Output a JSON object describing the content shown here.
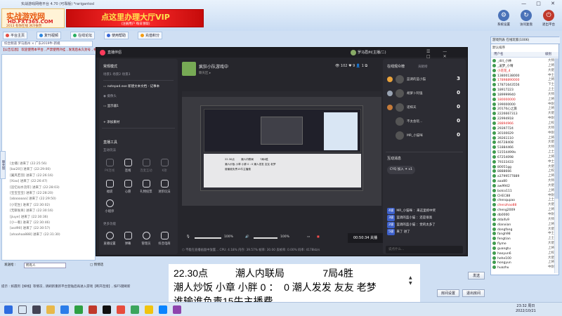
{
  "app": {
    "title": "实战游戏网络平台 4.70 (可靠版) *rarigantosl",
    "logo_big": "实战游戏网",
    "logo_url": "HD.FXT365.COM",
    "logo_sub": "2013 有你在线 冰冷依然",
    "vip_text": "点这里办理大厅VIP",
    "vip_sub": "(注册用户 每日领取)",
    "window_controls": "— □ ✕"
  },
  "top_buttons": [
    {
      "label": "系统设置",
      "icon": "gear-icon",
      "glyph": "⚙"
    },
    {
      "label": "访问复盘",
      "icon": "share-icon",
      "glyph": "↻"
    },
    {
      "label": "退出平台",
      "icon": "exit-icon",
      "glyph": "⏻"
    }
  ],
  "toolbar": [
    {
      "label": "平台主页",
      "color": "#e54d42"
    },
    {
      "label": "复刊视频",
      "color": "#2e86de"
    },
    {
      "label": "在线论坛",
      "color": "#27ae60"
    },
    {
      "label": "使用帮助",
      "color": "#3867d6"
    },
    {
      "label": "充值积分",
      "color": "#f39c12"
    }
  ],
  "chat": {
    "tabs": "综合频道   罗马眉州 × 广东2019牛·新规",
    "marquee": "【公告信息】 欢迎使用本平台 , 严禁使用外挂 , 发现后永久封号 , 祝您游戏愉快",
    "side_tab": "聊天窗",
    "log": [
      "[主播] 进来了 (22:25:56)",
      "[bai20]] 进来了 (22:29:00)",
      "[翼风若羽] 进来了 (22:26:16)",
      "[Xiao] 进来了 (22:26:47)",
      "[追忆似水流年] 进来了 (22:28:03)",
      "[宝宝宝宝] 进来了 (22:28:20)",
      "[abaaaaaa] 进来了 (22:29:50)",
      "[小花生] 进来了 (22:30:02)",
      "[无聊发呆] 进来了 (22:30:16)",
      "[jiuye] 进来了 (22:30:36)",
      "[小一看] 进来了 (22:30:46)",
      "[asd90] 进来了 (22:30:57)",
      "[ahaahaa888] 进来了 (22:31:30)"
    ]
  },
  "right_panel": {
    "tabs": "游戏列表   在线玩家(1006)",
    "default_filter": "默认排序",
    "col_user": "用户名",
    "col_level": "级别",
    "users": [
      {
        "name": "_dill_小林",
        "tag": "大师",
        "red": false
      },
      {
        "name": "_凌梦_小晴",
        "tag": "上将",
        "red": false
      },
      {
        "name": "小花花_4",
        "tag": "大佬",
        "red": true
      },
      {
        "name": "13800138000",
        "tag": "中士",
        "red": false
      },
      {
        "name": "17898890000",
        "tag": "上将",
        "red": true
      },
      {
        "name": "17871643556",
        "tag": "下士",
        "red": false
      },
      {
        "name": "18917223",
        "tag": "上士",
        "red": false
      },
      {
        "name": "189999940",
        "tag": "大师",
        "red": false
      },
      {
        "name": "180000000",
        "tag": "上将",
        "red": true
      },
      {
        "name": "199000000",
        "tag": "中尉",
        "red": false
      },
      {
        "name": "20170心之旅",
        "tag": "上将",
        "red": false
      },
      {
        "name": "2226667313",
        "tag": "大佬",
        "red": false
      },
      {
        "name": "22994918",
        "tag": "中尉",
        "red": false
      },
      {
        "name": "28894966",
        "tag": "上校",
        "red": true
      },
      {
        "name": "29397724",
        "tag": "大师",
        "red": false
      },
      {
        "name": "30100029",
        "tag": "中尉",
        "red": false
      },
      {
        "name": "39261110",
        "tag": "上将",
        "red": false
      },
      {
        "name": "46728408",
        "tag": "大佬",
        "red": false
      },
      {
        "name": "51884466",
        "tag": "大师",
        "red": false
      },
      {
        "name": "51554499ls",
        "tag": "上士",
        "red": false
      },
      {
        "name": "67254098",
        "tag": "上将",
        "red": false
      },
      {
        "name": "79333433",
        "tag": "中士",
        "red": false
      },
      {
        "name": "80051gg",
        "tag": "大佬",
        "red": false
      },
      {
        "name": "8888666",
        "tag": "上校",
        "red": false
      },
      {
        "name": "a3799577889",
        "tag": "上将",
        "red": false
      },
      {
        "name": "aaa80",
        "tag": "大师",
        "red": false
      },
      {
        "name": "aw9942",
        "tag": "大佬",
        "red": false
      },
      {
        "name": "bolco111",
        "tag": "上将",
        "red": false
      },
      {
        "name": "CHEC88",
        "tag": "中尉",
        "red": false
      },
      {
        "name": "chenqupao",
        "tag": "上士",
        "red": false
      },
      {
        "name": "chenzhao88",
        "tag": "大佬",
        "red": true
      },
      {
        "name": "cheng2009",
        "tag": "上将",
        "red": false
      },
      {
        "name": "db0000",
        "tag": "中尉",
        "red": false
      },
      {
        "name": "ddaifu9",
        "tag": "大师",
        "red": false
      },
      {
        "name": "dianxian",
        "tag": "上将",
        "red": false
      },
      {
        "name": "dongfang",
        "tag": "大佬",
        "red": false
      },
      {
        "name": "fangh98",
        "tag": "中士",
        "red": false
      },
      {
        "name": "fengtian",
        "tag": "上士",
        "red": false
      },
      {
        "name": "flyme",
        "tag": "大佬",
        "red": false
      },
      {
        "name": "guangtu",
        "tag": "上将",
        "red": false
      },
      {
        "name": "haoyun6",
        "tag": "上校",
        "red": false
      },
      {
        "name": "hehe100",
        "tag": "大佬",
        "red": false
      },
      {
        "name": "hongyun",
        "tag": "上将",
        "red": false
      },
      {
        "name": "huazhu",
        "tag": "中尉",
        "red": false
      }
    ]
  },
  "bottom": {
    "send_label": "发送给 :",
    "send_target": "所有人",
    "private_chk": "□ 悄悄话",
    "tips": "提示 : 如遇到【掉线】等情况 , 请刷新重新平台登陆后再进入游戏【断开连接】, 按F5键刷新",
    "send_btn": "发送",
    "btn_setting": "房间设置",
    "btn_exit": "退出房间"
  },
  "stream": {
    "title": "直播伴侣",
    "user_name": "罗马眉州(主播/二)",
    "section_scene": "常规模式",
    "scene_tabs": "场景1   场景2   场景3",
    "source_window": "notepad.exe 新建文本文档 - 记事本",
    "source_camera": "摄像头",
    "source_display": "显示器1",
    "add_source": "+ 添加素材",
    "section_tools": "直播工具",
    "section_interact": "互动玩法",
    "interact_items": [
      "PK连线",
      "连线",
      "连麦互动",
      "K歌",
      "福袋",
      "心愿",
      "礼物投票",
      "进阶玩法",
      "小程序"
    ],
    "section_more": "更多功能",
    "more_items": [
      "直播设置",
      "弹幕",
      "管理员",
      "抖音电商"
    ],
    "room_title": "疯狂小队游戏中",
    "room_sub": "聊天区 ▸",
    "stats": "👁 102   ♥ 9   👤 1   ⧉",
    "preview_caption_1": "22.30点        潮人内联局        7局4胜",
    "preview_caption_2": "潮人炒饭 小章 小胖 0 : 0 潮人发发 友友 老梦",
    "preview_caption_3": "谁输谁负责15牛主播费",
    "vol_left": "100%",
    "vol_right": "100%",
    "timer": "00:50:34 关播",
    "status": "⬡ 不能在直播画面中放置... CPU: 4.18%  内存: 39.57%  帧率: 30.00  丢帧率: 0.00%  码率: 4178kb/s",
    "viewers_title": "在线观众榜",
    "viewers_tab2": "贡献榜",
    "viewers": [
      {
        "name": "蓝调的蓝小猫",
        "score": "3"
      },
      {
        "name": "胡萝卜阿强",
        "score": "0"
      },
      {
        "name": "诺梓天",
        "score": "0"
      },
      {
        "name": "不太会玩...",
        "score": "0"
      },
      {
        "name": "MR_小猫咪",
        "score": "0"
      }
    ],
    "messages_title": "互动消息",
    "messages_pin": "CYQ 加入 ✦ x1",
    "messages": [
      {
        "tag": "4级",
        "text": "MR_小猫咪 ：来这里抓中奖"
      },
      {
        "tag": "3级",
        "text": "蓝调的蓝小猫 ：还是很高"
      },
      {
        "tag": "2级",
        "text": "蓝调的蓝小猫 ：觉的太多了"
      },
      {
        "tag": "5级",
        "text": "来了 进了"
      }
    ],
    "input_placeholder": "说点什么..."
  },
  "overlay": {
    "line1": "22.30点          潮人内联局              7局4胜",
    "line2": "潮人炒饭 小章 小胖 0 ：  0 潮人发发 友友 老梦",
    "line3": "谁输谁负责15牛主播费"
  },
  "taskbar": {
    "time": "23:32 周日",
    "date": "2022/10/21"
  }
}
